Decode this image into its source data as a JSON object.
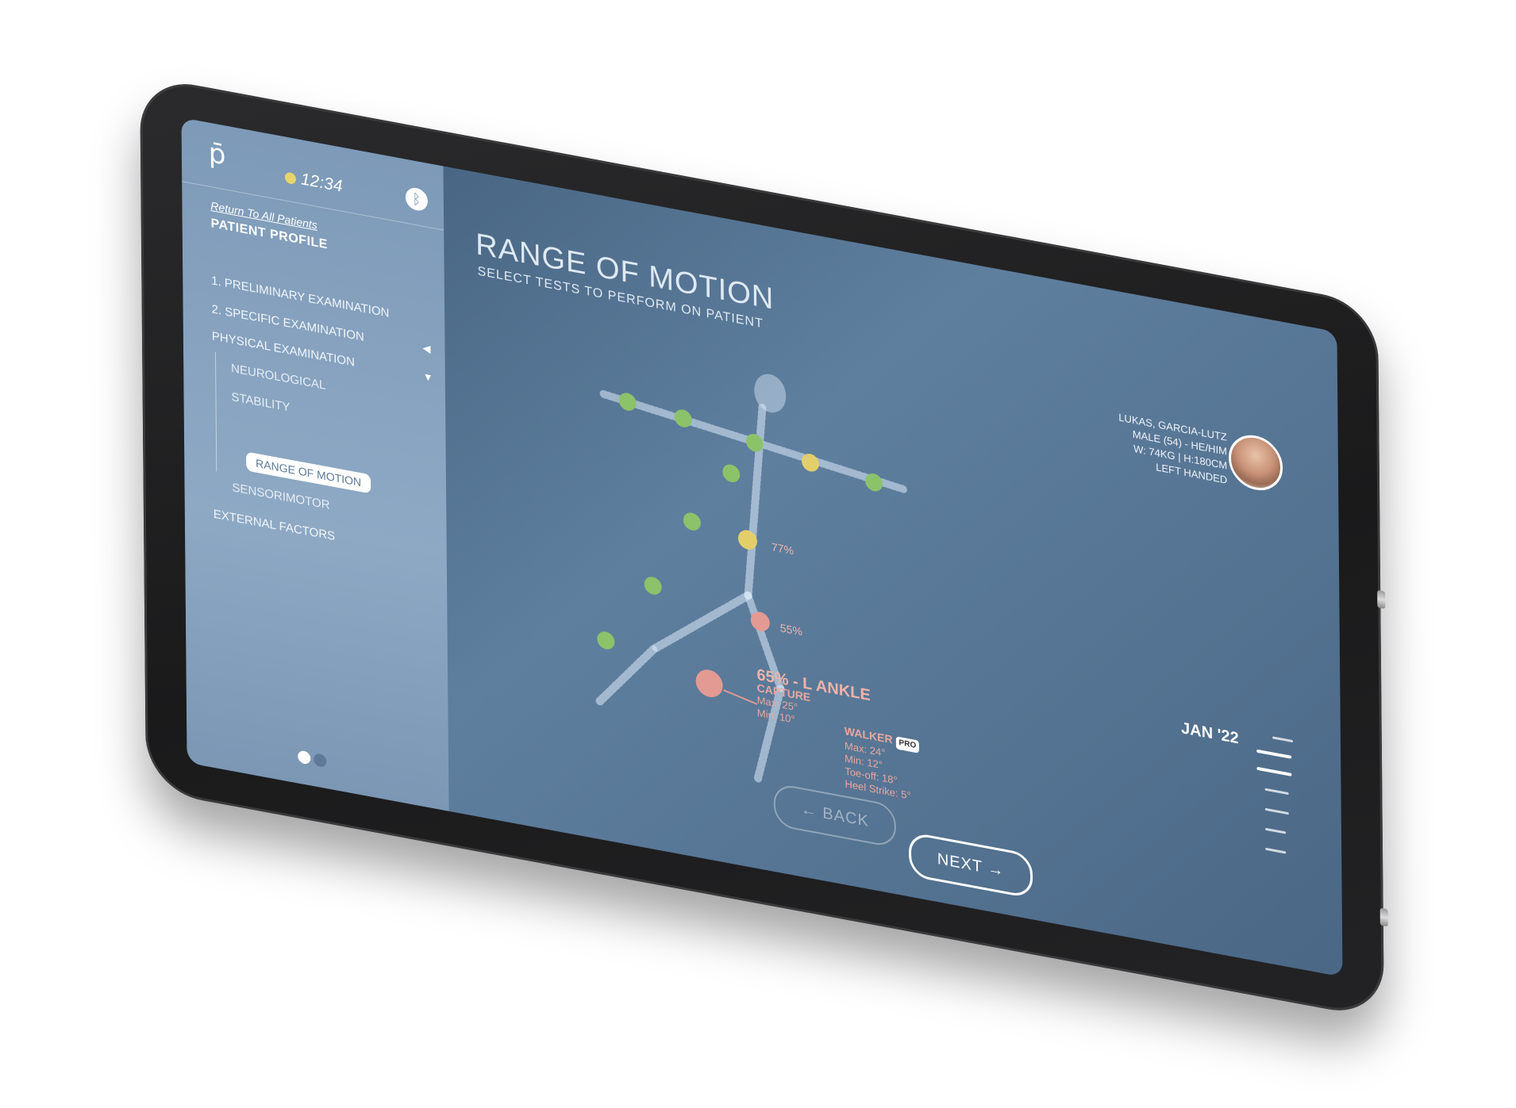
{
  "sidebar": {
    "logo": "p̄",
    "time": "12:34",
    "bluetooth_icon": "bluetooth-icon",
    "return_link": "Return To All Patients",
    "profile_title": "PATIENT PROFILE",
    "items": [
      {
        "label": "1. PRELIMINARY EXAMINATION"
      },
      {
        "label": "2. SPECIFIC EXAMINATION"
      },
      {
        "label": "PHYSICAL EXAMINATION"
      },
      {
        "label": "NEUROLOGICAL"
      },
      {
        "label": "STABILITY"
      },
      {
        "label": "RANGE OF MOTION"
      },
      {
        "label": "SENSORIMOTOR"
      },
      {
        "label": "EXTERNAL FACTORS"
      }
    ],
    "pager": {
      "pages": 2,
      "active": 1
    }
  },
  "main": {
    "title": "RANGE OF MOTION",
    "subtitle": "SELECT TESTS TO PERFORM ON PATIENT",
    "patient": {
      "name": "LUKAS, GARCIA-LUTZ",
      "demographics": "MALE (54) - HE/HIM",
      "measurements": "W: 74KG | H:180CM",
      "handedness": "LEFT HANDED"
    },
    "joint_labels": {
      "hip": "77%",
      "knee": "55%"
    },
    "timeline_label": "JAN '22",
    "detail": {
      "headline": "65% - L ANKLE",
      "capture": {
        "title": "CAPTURE",
        "max": "Max: 25°",
        "min": "Min: 10°"
      },
      "walker": {
        "title": "WALKER",
        "badge": "PRO",
        "max": "Max: 24°",
        "min": "Min: 12°",
        "toe_off": "Toe-off: 18°",
        "heel_strike": "Heel Strike: 5°"
      }
    },
    "buttons": {
      "back": "← BACK",
      "next": "NEXT →"
    }
  },
  "colors": {
    "sidebar": "#8ea9c4",
    "screen": "#5f7f9f",
    "joint_good": "#8cc26a",
    "joint_warn": "#e3cf6a",
    "joint_bad": "#e39a93",
    "device": "#1f1f21"
  }
}
